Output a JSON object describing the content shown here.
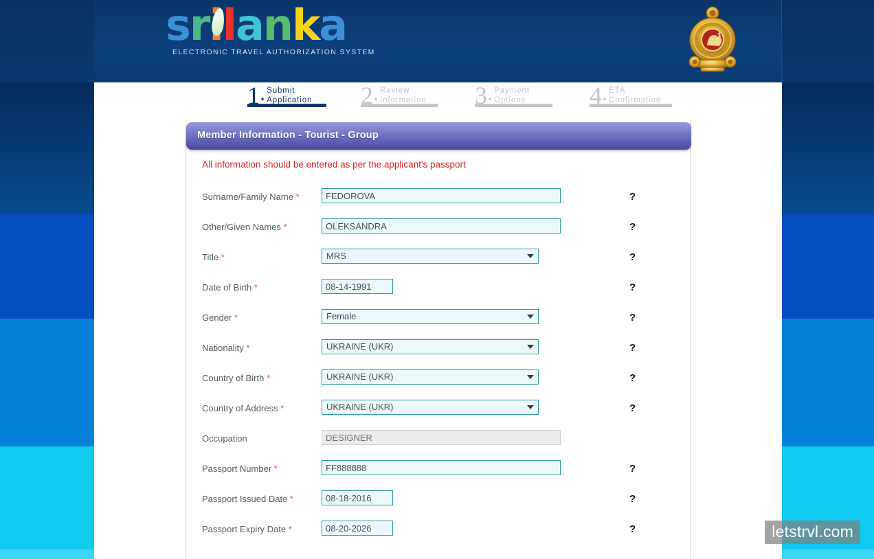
{
  "site": {
    "logo_word_parts": [
      "s",
      "r",
      "i",
      "l",
      "a",
      "n",
      "k",
      "a"
    ],
    "logo_tagline": "ELECTRONIC TRAVEL AUTHORIZATION SYSTEM",
    "emblem_name": "sri-lanka-national-emblem"
  },
  "steps": [
    {
      "number": "1",
      "dot": ".",
      "line1": "Submit",
      "line2": "Application",
      "state": "active"
    },
    {
      "number": "2",
      "dot": ".",
      "line1": "Review",
      "line2": "Information",
      "state": "done"
    },
    {
      "number": "3",
      "dot": ".",
      "line1": "Payment",
      "line2": "Options",
      "state": "done"
    },
    {
      "number": "4",
      "dot": ".",
      "line1": "ETA",
      "line2": "Confirmation",
      "state": "done"
    }
  ],
  "panel": {
    "title": "Member Information - Tourist - Group",
    "notice": "All information should be entered as per the applicant's passport",
    "help_glyph": "?"
  },
  "fields": {
    "surname": {
      "label": "Surname/Family Name",
      "required": "*",
      "value": "FEDOROVA"
    },
    "given_names": {
      "label": "Other/Given Names",
      "required": "*",
      "value": "OLEKSANDRA"
    },
    "title": {
      "label": "Title",
      "required": "*",
      "value": "MRS"
    },
    "dob": {
      "label": "Date of Birth",
      "required": "*",
      "value": "08-14-1991"
    },
    "gender": {
      "label": "Gender",
      "required": "*",
      "value": "Female"
    },
    "nationality": {
      "label": "Nationality",
      "required": "*",
      "value": "UKRAINE (UKR)"
    },
    "country_birth": {
      "label": "Country of Birth",
      "required": "*",
      "value": "UKRAINE (UKR)"
    },
    "country_address": {
      "label": "Country of Address",
      "required": "*",
      "value": "UKRAINE (UKR)"
    },
    "occupation": {
      "label": "Occupation",
      "required": "",
      "value": "DESIGNER"
    },
    "passport_number": {
      "label": "Passport Number",
      "required": "*",
      "value": "FF888888"
    },
    "passport_issued": {
      "label": "Passport Issued Date",
      "required": "*",
      "value": "08-18-2016"
    },
    "passport_expiry": {
      "label": "Passport Expiry Date",
      "required": "*",
      "value": "08-20-2026"
    }
  },
  "watermark": {
    "text": "letstrvl.com"
  },
  "colors": {
    "header_blue": "#0b3a73",
    "panel_purple": "#5b5fb4",
    "field_bg": "#eaf8fa",
    "field_border": "#2e9a9a",
    "notice_red": "#e02020",
    "step_active": "#16356a",
    "step_inactive": "#c3c6ca"
  }
}
